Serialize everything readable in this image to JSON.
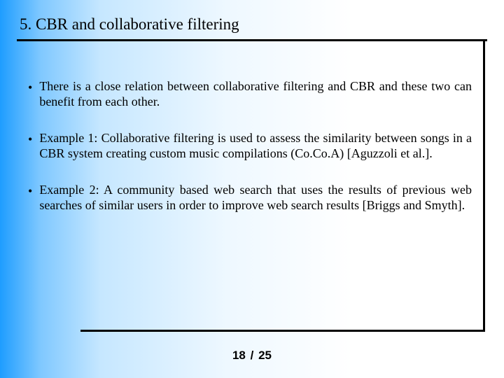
{
  "title": "5. CBR and collaborative filtering",
  "bullets": [
    "There is a close relation between collaborative filtering and CBR and these two can benefit from each other.",
    "Example 1: Collaborative filtering is used to assess the similarity between songs in a CBR system creating custom music compilations (Co.Co.A) [Aguzzoli et al.].",
    "Example 2: A community based web search that uses the results of previous web searches of similar users in order to improve web search results [Briggs and Smyth]."
  ],
  "page": {
    "current": "18",
    "sep": "/",
    "total": "25"
  }
}
